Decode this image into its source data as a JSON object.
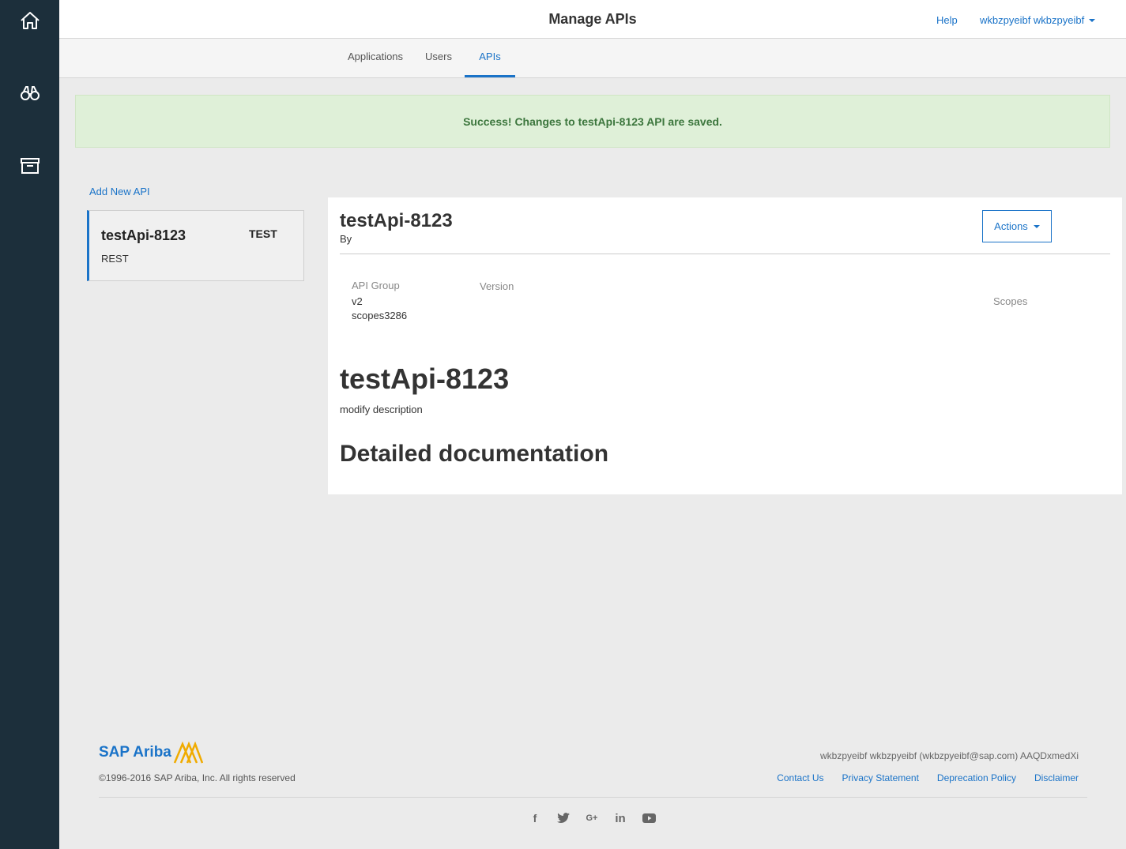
{
  "colors": {
    "sidebar": "#1c2f3b",
    "accent": "#1a73c8",
    "success_bg": "#dff0d8",
    "success_text": "#3c763d",
    "logo_mark": "#f0ab00"
  },
  "sidebar": {
    "icons": [
      "home-icon",
      "binoculars-icon",
      "archive-icon"
    ]
  },
  "header": {
    "title": "Manage APIs",
    "help": "Help",
    "user": "wkbzpyeibf wkbzpyeibf"
  },
  "tabs": [
    {
      "label": "Applications",
      "active": false
    },
    {
      "label": "Users",
      "active": false
    },
    {
      "label": "APIs",
      "active": true
    }
  ],
  "alert": {
    "message": "Success! Changes to testApi-8123 API are saved."
  },
  "list": {
    "add_label": "Add New API",
    "items": [
      {
        "name": "testApi-8123",
        "badge": "TEST",
        "type": "REST"
      }
    ]
  },
  "detail": {
    "title": "testApi-8123",
    "by": "By",
    "actions_label": "Actions",
    "meta": {
      "api_group_label": "API Group",
      "version_label": "Version",
      "scopes_label": "Scopes",
      "value_1": "v2",
      "value_2": "scopes3286"
    },
    "big_title": "testApi-8123",
    "description": "modify description",
    "doc_heading": "Detailed documentation"
  },
  "footer": {
    "brand": "SAP Ariba",
    "copyright": "©1996-2016 SAP Ariba, Inc. All rights reserved",
    "user_info": "wkbzpyeibf wkbzpyeibf (wkbzpyeibf@sap.com) AAQDxmedXi",
    "links": [
      "Contact Us",
      "Privacy Statement",
      "Deprecation Policy",
      "Disclaimer"
    ],
    "social": {
      "facebook": "f",
      "google_plus": "G+",
      "linkedin": "in"
    }
  }
}
